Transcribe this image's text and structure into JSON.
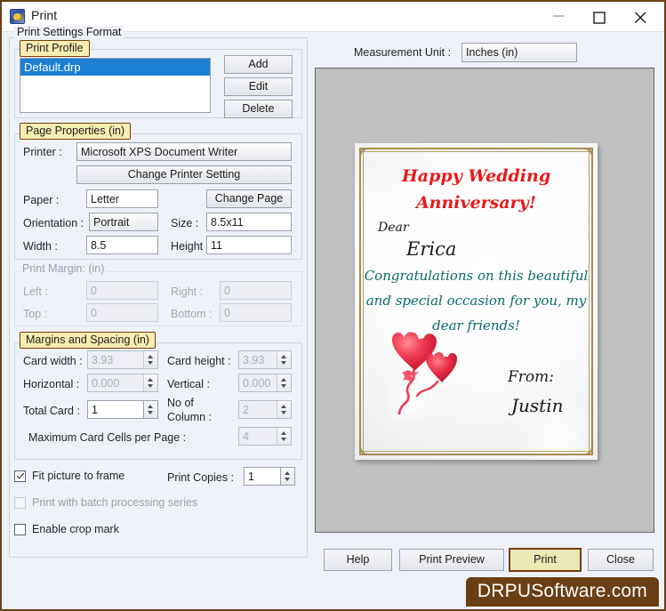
{
  "window": {
    "title": "Print",
    "icon": "app-icon",
    "minimize_label": "—",
    "maximize_label": "□",
    "close_label": "✕"
  },
  "groups": {
    "print_settings_format": "Print Settings Format",
    "print_profile": "Print Profile",
    "page_properties": "Page Properties  (in)",
    "print_margin": "Print Margin: (in)",
    "margins_and_spacing": "Margins and Spacing  (in)"
  },
  "profile": {
    "items": [
      "Default.drp"
    ],
    "selected": "Default.drp",
    "add_label": "Add",
    "edit_label": "Edit",
    "delete_label": "Delete"
  },
  "page_properties": {
    "printer_label": "Printer :",
    "printer_value": "Microsoft XPS Document Writer",
    "change_printer_setting_label": "Change Printer Setting",
    "paper_label": "Paper :",
    "paper_value": "Letter",
    "change_page_label": "Change Page",
    "orientation_label": "Orientation :",
    "orientation_value": "Portrait",
    "size_label": "Size :",
    "size_value": "8.5x11",
    "width_label": "Width :",
    "width_value": "8.5",
    "height_label": "Height :",
    "height_value": "11"
  },
  "print_margin": {
    "left_label": "Left :",
    "left_value": "0",
    "right_label": "Right :",
    "right_value": "0",
    "top_label": "Top :",
    "top_value": "0",
    "bottom_label": "Bottom :",
    "bottom_value": "0"
  },
  "margins_spacing": {
    "card_width_label": "Card width :",
    "card_width_value": "3.93",
    "card_height_label": "Card height :",
    "card_height_value": "3.93",
    "horizontal_label": "Horizontal :",
    "horizontal_value": "0.000",
    "vertical_label": "Vertical :",
    "vertical_value": "0.000",
    "total_card_label": "Total Card :",
    "total_card_value": "1",
    "no_of_column_label": "No of Column :",
    "no_of_column_value": "2",
    "max_cells_label": "Maximum Card Cells per Page :",
    "max_cells_value": "4"
  },
  "options": {
    "fit_picture_label": "Fit picture to frame",
    "fit_picture_checked": true,
    "batch_label": "Print with batch processing series",
    "batch_checked": false,
    "crop_mark_label": "Enable crop mark",
    "crop_mark_checked": false,
    "print_copies_label": "Print Copies :",
    "print_copies_value": "1"
  },
  "measurement": {
    "label": "Measurement Unit :",
    "value": "Inches (in)"
  },
  "card_preview": {
    "title_line1": "Happy Wedding",
    "title_line2": "Anniversary!",
    "dear_label": "Dear",
    "recipient": "Erica",
    "message_line1": "Congratulations on this beautiful",
    "message_line2": "and special occasion for you, my",
    "message_line3": "dear friends!",
    "from_label": "From:",
    "sender": "Justin",
    "graphic": "heart-balloons"
  },
  "footer": {
    "help_label": "Help",
    "print_preview_label": "Print Preview",
    "print_label": "Print",
    "close_label": "Close",
    "watermark": "DRPUSoftware.com"
  },
  "colors": {
    "accent_border": "#7a3b12",
    "accent_fill": "#f6edb1",
    "selection": "#1b7fd4",
    "card_title": "#e8191b",
    "card_message": "#0b6a6d",
    "watermark_bg": "#6b3f14"
  }
}
